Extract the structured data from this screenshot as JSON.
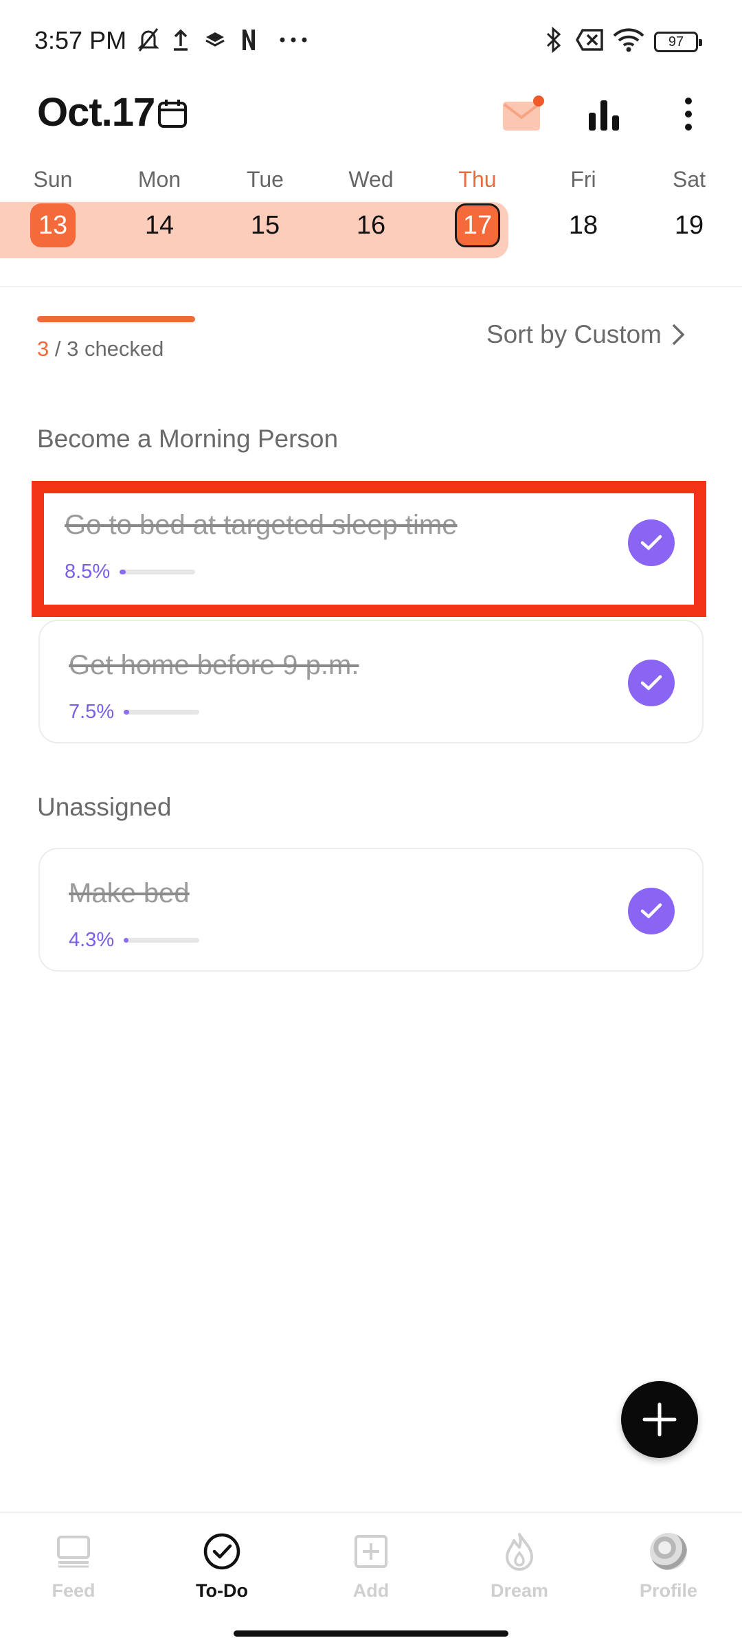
{
  "status_bar": {
    "time": "3:57 PM",
    "battery": "97",
    "icons": [
      "bell-off-icon",
      "upload-icon",
      "layers-icon",
      "netflix-icon",
      "more-dots-icon",
      "bluetooth-icon",
      "sim-x-icon",
      "wifi-icon",
      "battery-icon"
    ]
  },
  "header": {
    "date": "Oct.17",
    "icons": [
      "calendar-icon",
      "mail-icon",
      "stats-icon",
      "more-vertical-icon"
    ]
  },
  "week": {
    "days": [
      {
        "name": "Sun",
        "num": "13"
      },
      {
        "name": "Mon",
        "num": "14"
      },
      {
        "name": "Tue",
        "num": "15"
      },
      {
        "name": "Wed",
        "num": "16"
      },
      {
        "name": "Thu",
        "num": "17"
      },
      {
        "name": "Fri",
        "num": "18"
      },
      {
        "name": "Sat",
        "num": "19"
      }
    ]
  },
  "summary": {
    "checked_done": "3",
    "checked_rest": " / 3 checked",
    "sort_label": "Sort by Custom"
  },
  "sections": [
    {
      "title": "Become a Morning Person",
      "tasks": [
        {
          "name": "Go to bed at targeted sleep time",
          "pct": "8.5%",
          "fill": 0.085
        },
        {
          "name": "Get home before 9 p.m.",
          "pct": "7.5%",
          "fill": 0.075
        }
      ]
    },
    {
      "title": "Unassigned",
      "tasks": [
        {
          "name": "Make bed",
          "pct": "4.3%",
          "fill": 0.043
        }
      ]
    }
  ],
  "nav": {
    "items": [
      {
        "label": "Feed"
      },
      {
        "label": "To-Do"
      },
      {
        "label": "Add"
      },
      {
        "label": "Dream"
      },
      {
        "label": "Profile"
      }
    ]
  },
  "colors": {
    "accent": "#F46A3B",
    "check": "#8A64F2",
    "week_strip": "#FDCDBC"
  }
}
